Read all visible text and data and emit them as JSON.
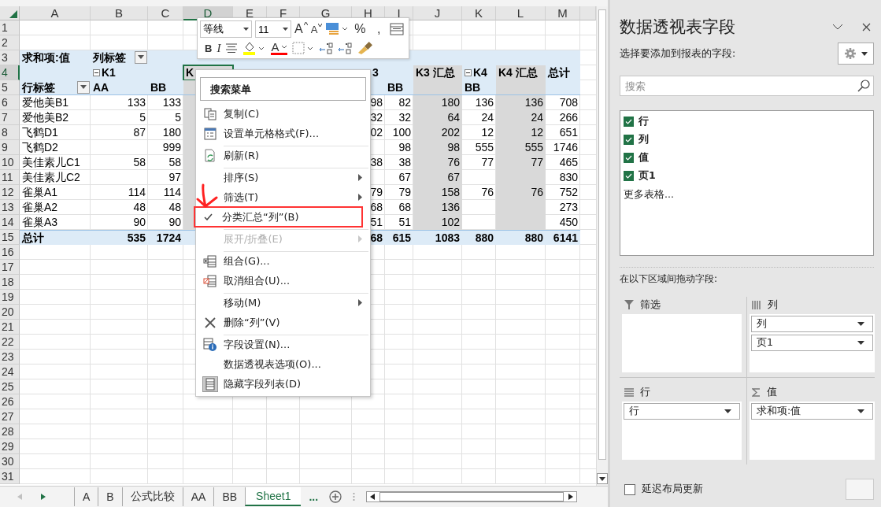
{
  "columns": [
    {
      "label": "A",
      "selected": false
    },
    {
      "label": "B",
      "selected": false
    },
    {
      "label": "C",
      "selected": false
    },
    {
      "label": "D",
      "selected": true,
      "subtotal": true
    },
    {
      "label": "E",
      "selected": false
    },
    {
      "label": "F",
      "selected": false
    },
    {
      "label": "G",
      "selected": false
    },
    {
      "label": "H",
      "selected": false
    },
    {
      "label": "I",
      "selected": false
    },
    {
      "label": "J",
      "selected": false,
      "subtotal": true
    },
    {
      "label": "K",
      "selected": false
    },
    {
      "label": "L",
      "selected": false,
      "subtotal": true
    },
    {
      "label": "M",
      "selected": false
    }
  ],
  "rows": [
    {
      "number": "1",
      "kind": "plain",
      "selected": false
    },
    {
      "number": "2",
      "kind": "plain",
      "selected": false
    },
    {
      "number": "3",
      "kind": "title",
      "selected": false,
      "cells": [
        "求和项:值",
        {
          "text": "列标签",
          "kind": "dropdown"
        },
        null,
        null,
        null,
        null,
        null,
        null,
        null,
        null,
        null,
        null,
        null
      ]
    },
    {
      "number": "4",
      "kind": "header",
      "selected": true,
      "cells": [
        null,
        {
          "text": "K1",
          "kind": "collapse"
        },
        null,
        {
          "text": "K",
          "kind": "active"
        },
        null,
        null,
        null,
        {
          "text": "3",
          "kind": "clipped"
        },
        null,
        "K3 汇总",
        {
          "text": "K4",
          "kind": "collapse"
        },
        "K4 汇总",
        "总计"
      ]
    },
    {
      "number": "5",
      "kind": "header",
      "selected": false,
      "cells": [
        {
          "text": "行标签",
          "kind": "dropdown"
        },
        "AA",
        "BB",
        null,
        null,
        null,
        null,
        null,
        "BB",
        null,
        "BB",
        null,
        null
      ]
    },
    {
      "number": "6",
      "kind": "data",
      "selected": false,
      "cells": [
        "爱他美B1",
        "133",
        "133",
        null,
        null,
        null,
        null,
        "98",
        "82",
        "180",
        "136",
        "136",
        "708"
      ]
    },
    {
      "number": "7",
      "kind": "data",
      "selected": false,
      "cells": [
        "爱他美B2",
        "5",
        "5",
        null,
        null,
        null,
        null,
        "32",
        "32",
        "64",
        "24",
        "24",
        "266"
      ]
    },
    {
      "number": "8",
      "kind": "data",
      "selected": false,
      "cells": [
        "飞鹤D1",
        "87",
        "180",
        null,
        null,
        null,
        null,
        "02",
        "100",
        "202",
        "12",
        "12",
        "651"
      ]
    },
    {
      "number": "9",
      "kind": "data",
      "selected": false,
      "cells": [
        "飞鹤D2",
        null,
        "999",
        null,
        null,
        null,
        null,
        null,
        "98",
        "98",
        "555",
        "555",
        "1746"
      ]
    },
    {
      "number": "10",
      "kind": "data",
      "selected": false,
      "cells": [
        "美佳素儿C1",
        "58",
        "58",
        null,
        null,
        null,
        null,
        "38",
        "38",
        "76",
        "77",
        "77",
        "465"
      ]
    },
    {
      "number": "11",
      "kind": "data",
      "selected": false,
      "cells": [
        "美佳素儿C2",
        null,
        "97",
        null,
        null,
        null,
        null,
        null,
        "67",
        "67",
        null,
        null,
        "830"
      ]
    },
    {
      "number": "12",
      "kind": "data",
      "selected": false,
      "cells": [
        "雀巢A1",
        "114",
        "114",
        null,
        null,
        null,
        null,
        "79",
        "79",
        "158",
        "76",
        "76",
        "752"
      ]
    },
    {
      "number": "13",
      "kind": "data",
      "selected": false,
      "cells": [
        "雀巢A2",
        "48",
        "48",
        null,
        null,
        null,
        null,
        "68",
        "68",
        "136",
        null,
        null,
        "273"
      ]
    },
    {
      "number": "14",
      "kind": "data",
      "selected": false,
      "cells": [
        "雀巢A3",
        "90",
        "90",
        null,
        null,
        null,
        null,
        "51",
        "51",
        "102",
        null,
        null,
        "450"
      ]
    },
    {
      "number": "15",
      "kind": "total",
      "selected": false,
      "cells": [
        "总计",
        "535",
        "1724",
        null,
        null,
        null,
        null,
        "68",
        "615",
        "1083",
        "880",
        "880",
        "6141"
      ]
    },
    {
      "number": "16",
      "kind": "plain",
      "selected": false
    },
    {
      "number": "17",
      "kind": "plain",
      "selected": false
    },
    {
      "number": "18",
      "kind": "plain",
      "selected": false
    },
    {
      "number": "19",
      "kind": "plain",
      "selected": false
    },
    {
      "number": "20",
      "kind": "plain",
      "selected": false
    },
    {
      "number": "21",
      "kind": "plain",
      "selected": false
    },
    {
      "number": "22",
      "kind": "plain",
      "selected": false
    },
    {
      "number": "23",
      "kind": "plain",
      "selected": false
    },
    {
      "number": "24",
      "kind": "plain",
      "selected": false
    },
    {
      "number": "25",
      "kind": "plain",
      "selected": false
    },
    {
      "number": "26",
      "kind": "plain",
      "selected": false
    },
    {
      "number": "27",
      "kind": "plain",
      "selected": false
    },
    {
      "number": "28",
      "kind": "plain",
      "selected": false
    },
    {
      "number": "29",
      "kind": "plain",
      "selected": false
    },
    {
      "number": "30",
      "kind": "plain",
      "selected": false
    },
    {
      "number": "31",
      "kind": "plain",
      "selected": false
    }
  ],
  "mini_toolbar": {
    "font": "等线",
    "size": "11",
    "row1": [
      {
        "kind": "grow",
        "text": "A"
      },
      {
        "kind": "shrink",
        "text": "A"
      },
      {
        "kind": "accounting"
      },
      {
        "kind": "char",
        "text": "%"
      },
      {
        "kind": "char",
        "text": ","
      },
      {
        "kind": "table"
      }
    ],
    "row2": [
      {
        "kind": "char",
        "text": "B"
      },
      {
        "kind": "italic",
        "text": "I"
      },
      {
        "kind": "align"
      },
      {
        "kind": "fill"
      },
      {
        "kind": "font-color",
        "text": "A"
      },
      {
        "kind": "borders"
      },
      {
        "kind": "inc-decimal"
      },
      {
        "kind": "dec-decimal"
      },
      {
        "kind": "painter"
      }
    ]
  },
  "context_menu": {
    "search": {
      "placeholder": "搜索菜单"
    },
    "items": [
      {
        "text": "复制(C)",
        "separator": false,
        "submenu": false,
        "checked": false,
        "disabled": false,
        "highlighted": false
      },
      {
        "text": "设置单元格格式(F)...",
        "separator": false,
        "submenu": false,
        "checked": false,
        "disabled": false,
        "highlighted": false
      },
      {
        "text": "刷新(R)",
        "separator": true,
        "submenu": false,
        "checked": false,
        "disabled": false,
        "highlighted": false
      },
      {
        "text": "排序(S)",
        "separator": true,
        "submenu": true,
        "checked": false,
        "disabled": false,
        "highlighted": false
      },
      {
        "text": "筛选(T)",
        "separator": false,
        "submenu": true,
        "checked": false,
        "disabled": false,
        "highlighted": false
      },
      {
        "text": "分类汇总“列”(B)",
        "separator": false,
        "submenu": false,
        "checked": true,
        "disabled": false,
        "highlighted": true
      },
      {
        "text": "展开/折叠(E)",
        "separator": true,
        "submenu": true,
        "checked": false,
        "disabled": true,
        "highlighted": false
      },
      {
        "text": "组合(G)...",
        "separator": true,
        "submenu": false,
        "checked": false,
        "disabled": false,
        "highlighted": false
      },
      {
        "text": "取消组合(U)...",
        "separator": false,
        "submenu": false,
        "checked": false,
        "disabled": false,
        "highlighted": false
      },
      {
        "text": "移动(M)",
        "separator": true,
        "submenu": true,
        "checked": false,
        "disabled": false,
        "highlighted": false
      },
      {
        "text": "删除“列”(V)",
        "separator": false,
        "submenu": false,
        "checked": false,
        "disabled": false,
        "highlighted": false
      },
      {
        "text": "字段设置(N)...",
        "separator": true,
        "submenu": false,
        "checked": false,
        "disabled": false,
        "highlighted": false
      },
      {
        "text": "数据透视表选项(O)...",
        "separator": false,
        "submenu": false,
        "checked": false,
        "disabled": false,
        "highlighted": false
      },
      {
        "text": "隐藏字段列表(D)",
        "separator": false,
        "submenu": false,
        "checked": false,
        "disabled": false,
        "highlighted": false
      }
    ]
  },
  "sheet_tabs": [
    {
      "label": "A",
      "selected": false
    },
    {
      "label": "B",
      "selected": false
    },
    {
      "label": "公式比较",
      "selected": false
    },
    {
      "label": "AA",
      "selected": false
    },
    {
      "label": "BB",
      "selected": false
    },
    {
      "label": "Sheet1",
      "selected": true
    }
  ],
  "more_tabs": "...",
  "field_panel": {
    "title": "数据透视表字段",
    "subtitle": "选择要添加到报表的字段:",
    "search": {
      "placeholder": "搜索"
    },
    "fields": [
      {
        "label": "行",
        "checked": true
      },
      {
        "label": "列",
        "checked": true
      },
      {
        "label": "值",
        "checked": true
      },
      {
        "label": "页1",
        "checked": true
      }
    ],
    "more_tables": "更多表格...",
    "areas_label": "在以下区域间拖动字段:",
    "areas": [
      {
        "kind": "filter",
        "title": "筛选"
      },
      {
        "kind": "columns",
        "title": "列",
        "items": [
          "列",
          "页1"
        ]
      },
      {
        "kind": "rows",
        "title": "行",
        "items": [
          "行"
        ]
      },
      {
        "kind": "values",
        "title": "值",
        "items": [
          "求和项:值"
        ]
      }
    ],
    "defer_update": {
      "label": "延迟布局更新",
      "checked": false
    }
  }
}
